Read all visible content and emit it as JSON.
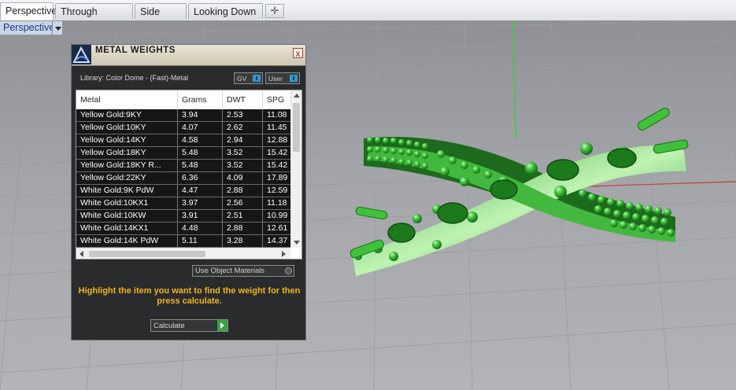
{
  "tabs": [
    {
      "label": "Perspective",
      "active": true
    },
    {
      "label": "Through Finger",
      "active": false
    },
    {
      "label": "Side View",
      "active": false
    },
    {
      "label": "Looking Down",
      "active": false
    }
  ],
  "tab_add_icon": "plus-icon",
  "viewport": {
    "label": "Perspective",
    "model_color": "#3fc43d",
    "grid_color": "#9a9ca0"
  },
  "panel": {
    "title": "METAL WEIGHTS",
    "close_label": "x",
    "library_text": "Library: Color Dome - (Fast)-Metal",
    "toggle_gv": "GV",
    "toggle_user": "User",
    "columns": [
      "Metal",
      "Grams",
      "DWT",
      "SPG"
    ],
    "rows": [
      [
        "Yellow Gold:9KY",
        "3.94",
        "2.53",
        "11.08"
      ],
      [
        "Yellow Gold:10KY",
        "4.07",
        "2.62",
        "11.45"
      ],
      [
        "Yellow Gold:14KY",
        "4.58",
        "2.94",
        "12.88"
      ],
      [
        "Yellow Gold:18KY",
        "5.48",
        "3.52",
        "15.42"
      ],
      [
        "Yellow Gold:18KY R...",
        "5.48",
        "3.52",
        "15.42"
      ],
      [
        "Yellow Gold:22KY",
        "6.36",
        "4.09",
        "17.89"
      ],
      [
        "White Gold:9K PdW",
        "4.47",
        "2.88",
        "12.59"
      ],
      [
        "White Gold:10KX1",
        "3.97",
        "2.56",
        "11.18"
      ],
      [
        "White Gold:10KW",
        "3.91",
        "2.51",
        "10.99"
      ],
      [
        "White Gold:14KX1",
        "4.48",
        "2.88",
        "12.61"
      ],
      [
        "White Gold:14K PdW",
        "5.11",
        "3.28",
        "14.37"
      ]
    ],
    "use_object_materials": "Use Object Materials",
    "hint": "Highlight the item you want to find the weight for then press calculate.",
    "calculate_label": "Calculate",
    "accent_color": "#f1b51e"
  }
}
